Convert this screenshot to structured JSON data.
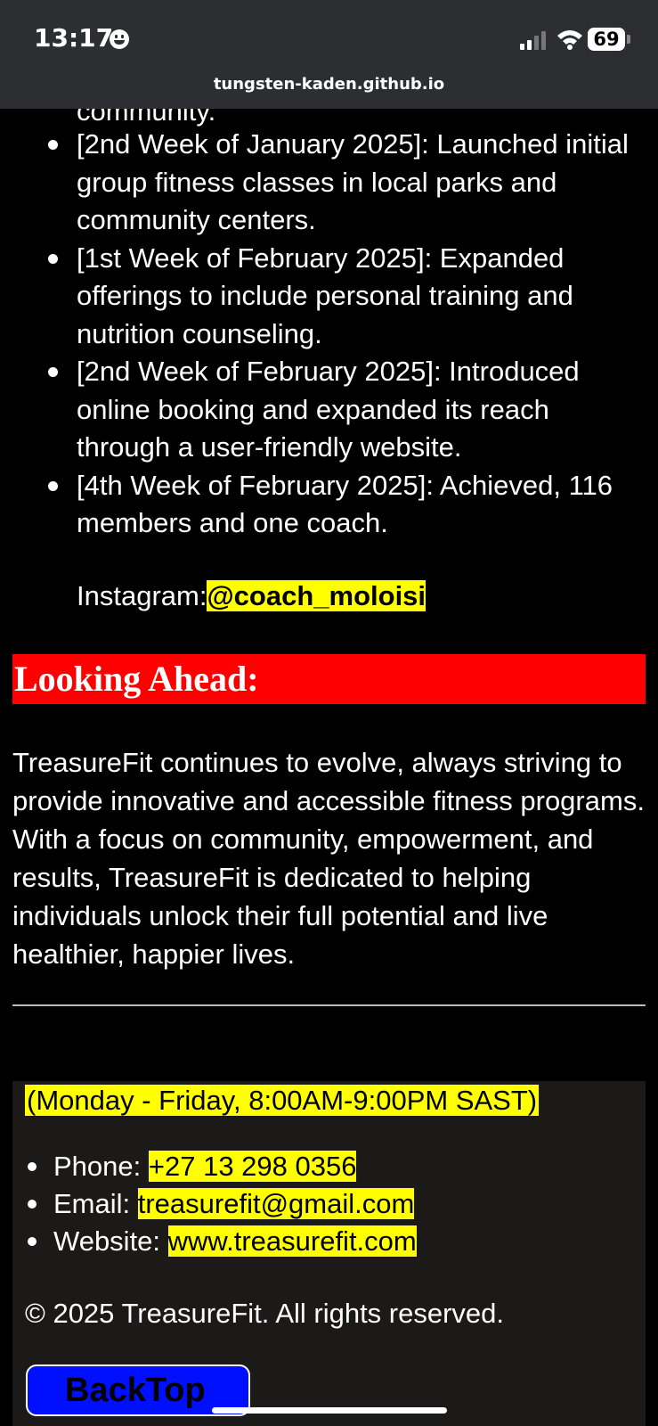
{
  "status_bar": {
    "time": "13:17",
    "battery": "69",
    "url": "tungsten-kaden.github.io"
  },
  "partial_line": "community.",
  "timeline": [
    "[2nd Week of January 2025]: Launched initial group fitness classes in local parks and community centers.",
    "[1st Week of February 2025]: Expanded offerings to include personal training and nutrition counseling.",
    "[2nd Week of February 2025]: Introduced online booking and expanded its reach through a user-friendly website.",
    "[4th Week of February 2025]: Achieved, 116 members and one coach."
  ],
  "instagram": {
    "label": "Instagram:",
    "handle": "@coach_moloisi"
  },
  "looking_ahead": {
    "heading": "Looking Ahead:",
    "paragraph": "TreasureFit continues to evolve, always striving to provide innovative and accessible fitness programs. With a focus on community, empowerment, and results, TreasureFit is dedicated to helping individuals unlock their full potential and live healthier, happier lives."
  },
  "footer": {
    "hours": "(Monday - Friday, 8:00AM-9:00PM SAST)",
    "phone_label": "Phone: ",
    "phone": "+27 13 298 0356",
    "email_label": "Email: ",
    "email": "treasurefit@gmail.com",
    "website_label": "Website: ",
    "website": "www.treasurefit.com",
    "copyright": "© 2025 TreasureFit. All rights reserved.",
    "back_top": "BackTop"
  },
  "colors": {
    "highlight": "#ffff00",
    "heading_bg": "#ff0000",
    "button_bg": "#0010ff",
    "footer_bg": "#1c1a19"
  }
}
